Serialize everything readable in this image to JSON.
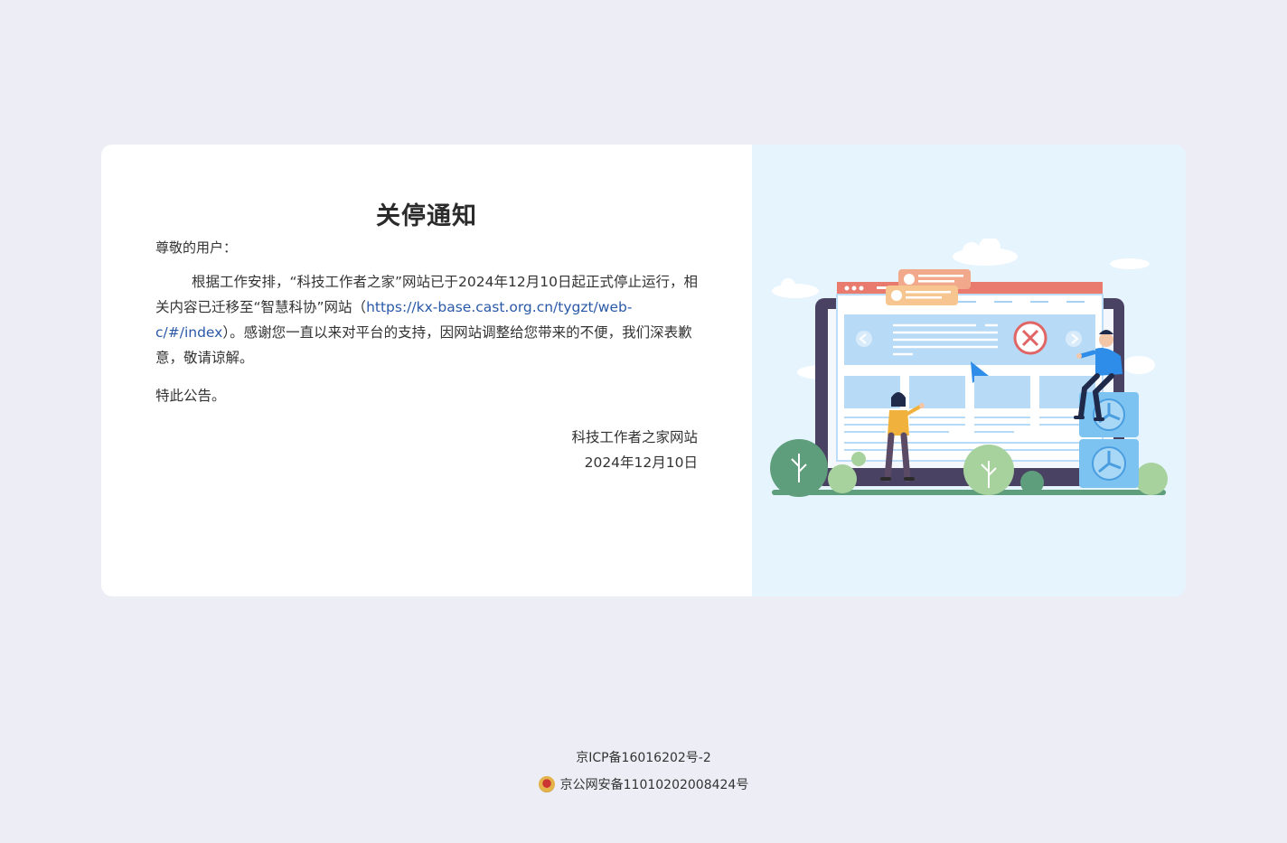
{
  "notice": {
    "title": "关停通知",
    "greeting": "尊敬的用户：",
    "body_before_link": "根据工作安排，“科技工作者之家”网站已于2024年12月10日起正式停止运行，相关内容已迁移至“智慧科协”网站（",
    "link_text": "https://kx-base.cast.org.cn/tygzt/web-c/#/index",
    "body_after_link": "）。感谢您一直以来对平台的支持，因网站调整给您带来的不便，我们深表歉意，敬请谅解。",
    "closing": "特此公告。",
    "signature": "科技工作者之家网站",
    "date": "2024年12月10日"
  },
  "illustration": {
    "icon": "website-closed-illustration"
  },
  "footer": {
    "icp": "京ICP备16016202号-2",
    "police": "京公网安备11010202008424号",
    "police_icon": "police-emblem-icon"
  },
  "colors": {
    "page_bg": "#ecedf5",
    "card_bg": "#ffffff",
    "illustration_bg": "#e6f4fe",
    "link": "#2a59a8",
    "error_red": "#e06666"
  }
}
